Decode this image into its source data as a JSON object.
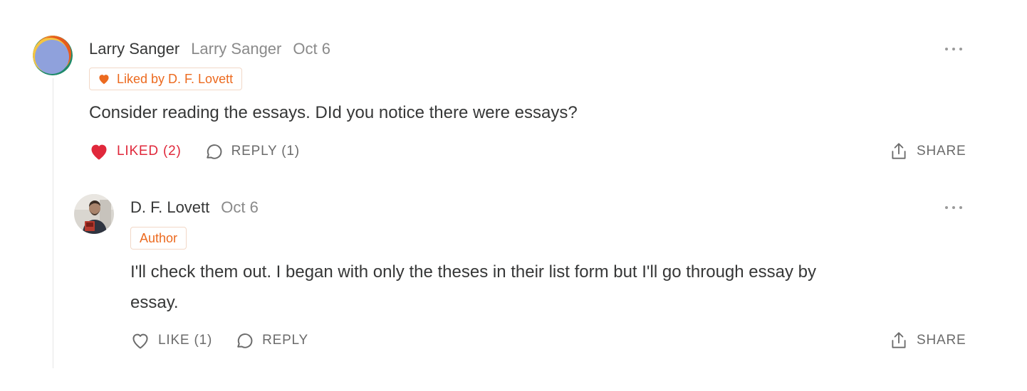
{
  "comments": [
    {
      "author": "Larry Sanger",
      "handle": "Larry Sanger",
      "date": "Oct 6",
      "badge": "Liked by D. F. Lovett",
      "text": "Consider reading the essays. DId you notice there were essays?",
      "like_label": "LIKED (2)",
      "reply_label": "REPLY (1)",
      "share_label": "SHARE"
    },
    {
      "author": "D. F. Lovett",
      "date": "Oct 6",
      "badge": "Author",
      "text_line1": "I'll check them out. I began with only the theses in their list form but I'll go through essay by",
      "text_line2": "essay.",
      "like_label": "LIKE (1)",
      "reply_label": "REPLY",
      "share_label": "SHARE"
    }
  ],
  "colors": {
    "accent_orange": "#ec6a1f",
    "liked_red": "#e0283b",
    "text": "#363737",
    "muted": "#8a8a8a"
  },
  "icons": [
    "heart-icon",
    "comment-bubble-icon",
    "share-icon",
    "more-dots-icon"
  ]
}
